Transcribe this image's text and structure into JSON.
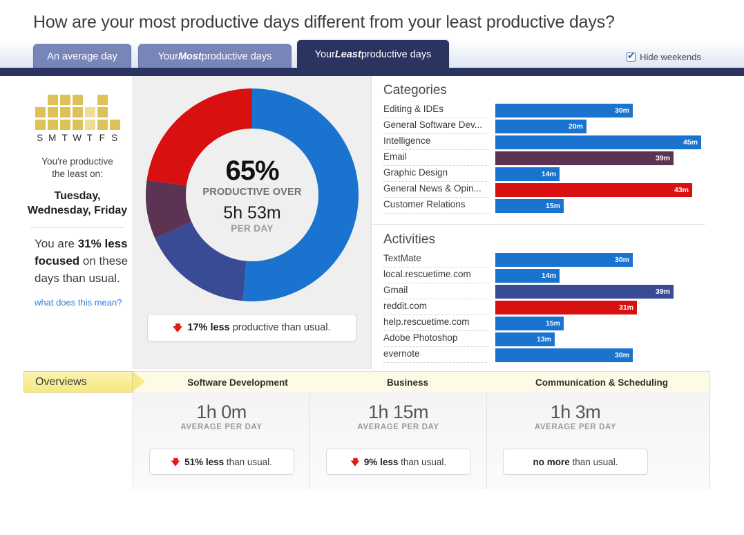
{
  "header": {
    "title": "How are your most productive days different from your least productive days?"
  },
  "tabs": [
    {
      "id": "tab-average",
      "prefix": "An average day",
      "emphasis": "",
      "suffix": "",
      "active": false
    },
    {
      "id": "tab-most",
      "prefix": "Your ",
      "emphasis": "Most",
      "suffix": " productive days",
      "active": false
    },
    {
      "id": "tab-least",
      "prefix": "Your ",
      "emphasis": "Least",
      "suffix": " productive days",
      "active": true
    }
  ],
  "options": {
    "hide_weekends_label": "Hide weekends",
    "hide_weekends_checked": true
  },
  "sidebar": {
    "day_initials": [
      "S",
      "M",
      "T",
      "W",
      "T",
      "F",
      "S"
    ],
    "day_bar_heights": [
      2,
      3,
      3,
      3,
      2,
      3,
      1
    ],
    "day_bar_colors": [
      "#dcc259",
      "#dcc259",
      "#dcc259",
      "#dcc259",
      "#f0dd9c",
      "#dcc259",
      "#dcc259"
    ],
    "note_line1": "You're productive",
    "note_line2": "the least on:",
    "days": "Tuesday, Wednesday, Friday",
    "focus_pre": "You are ",
    "focus_bold": "31% less focused",
    "focus_post": " on these days than usual.",
    "link": "what does this mean?"
  },
  "donut": {
    "percent": "65%",
    "percent_caption": "PRODUCTIVE OVER",
    "time": "5h 53m",
    "time_caption": "PER DAY",
    "segments": [
      {
        "name": "very-productive",
        "color": "#1a73ce",
        "start_deg": 0,
        "end_deg": 185
      },
      {
        "name": "productive",
        "color": "#3a4b96",
        "start_deg": 185,
        "end_deg": 246
      },
      {
        "name": "neutral",
        "color": "#5c3352",
        "start_deg": 246,
        "end_deg": 278
      },
      {
        "name": "distracting",
        "color": "#d81110",
        "start_deg": 278,
        "end_deg": 360
      }
    ]
  },
  "callout": {
    "icon": "arrow-down-icon",
    "bold": "17% less",
    "rest": " productive than usual."
  },
  "chart_data": [
    {
      "type": "bar",
      "title": "Categories",
      "orientation": "horizontal",
      "value_unit": "m",
      "xlim": [
        0,
        45
      ],
      "categories": [
        "Editing & IDEs",
        "General Software Dev...",
        "Intelligence",
        "Email",
        "Graphic Design",
        "General News & Opin...",
        "Customer Relations"
      ],
      "values": [
        30,
        20,
        45,
        39,
        14,
        43,
        15
      ],
      "value_labels": [
        "30m",
        "20m",
        "45m",
        "39m",
        "14m",
        "43m",
        "15m"
      ],
      "colors": [
        "#1a73ce",
        "#1a73ce",
        "#1a73ce",
        "#5c3352",
        "#1a73ce",
        "#d81110",
        "#1a73ce"
      ]
    },
    {
      "type": "bar",
      "title": "Activities",
      "orientation": "horizontal",
      "value_unit": "m",
      "xlim": [
        0,
        45
      ],
      "categories": [
        "TextMate",
        "local.rescuetime.com",
        "Gmail",
        "reddit.com",
        "help.rescuetime.com",
        "Adobe Photoshop",
        "evernote"
      ],
      "values": [
        30,
        14,
        39,
        31,
        15,
        13,
        30
      ],
      "value_labels": [
        "30m",
        "14m",
        "39m",
        "31m",
        "15m",
        "13m",
        "30m"
      ],
      "colors": [
        "#1a73ce",
        "#1a73ce",
        "#3a4b96",
        "#d81110",
        "#1a73ce",
        "#1a73ce",
        "#1a73ce"
      ]
    }
  ],
  "ribbon": {
    "tab_label": "Overviews",
    "columns": [
      "Software Development",
      "Business",
      "Communication & Scheduling"
    ]
  },
  "overview_columns": [
    {
      "value": "1h 0m",
      "caption": "AVERAGE PER DAY",
      "icon": "arrow-down-icon",
      "has_icon": true,
      "bold": "51% less",
      "rest": " than usual."
    },
    {
      "value": "1h 15m",
      "caption": "AVERAGE PER DAY",
      "icon": "arrow-down-icon",
      "has_icon": true,
      "bold": "9% less",
      "rest": " than usual."
    },
    {
      "value": "1h 3m",
      "caption": "AVERAGE PER DAY",
      "icon": "",
      "has_icon": false,
      "bold": "no more",
      "rest": " than usual."
    }
  ]
}
